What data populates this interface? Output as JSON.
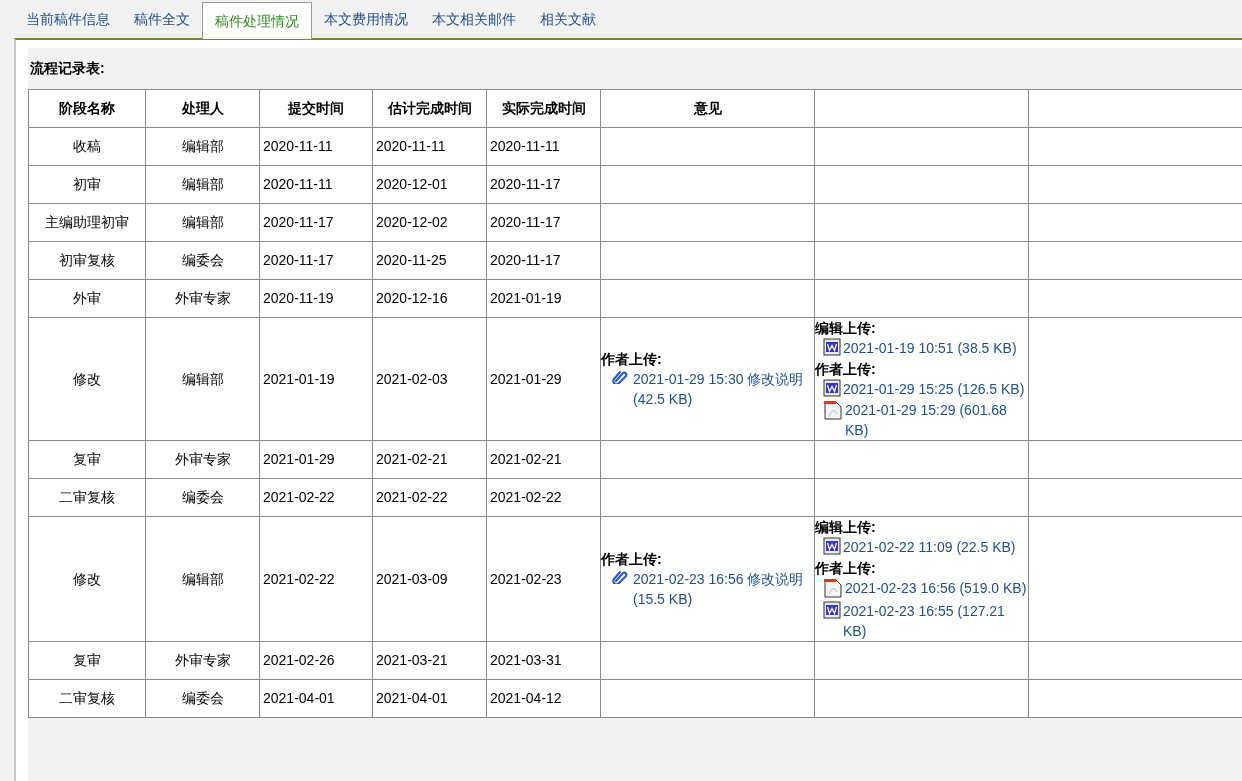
{
  "tabs": [
    {
      "label": "当前稿件信息",
      "selected": false
    },
    {
      "label": "稿件全文",
      "selected": false
    },
    {
      "label": "稿件处理情况",
      "selected": true
    },
    {
      "label": "本文费用情况",
      "selected": false
    },
    {
      "label": "本文相关邮件",
      "selected": false
    },
    {
      "label": "相关文献",
      "selected": false
    }
  ],
  "section_title": "流程记录表:",
  "table": {
    "columns": [
      "阶段名称",
      "处理人",
      "提交时间",
      "估计完成时间",
      "实际完成时间",
      "意见"
    ],
    "rows": [
      {
        "stage": "收稿",
        "handler": "编辑部",
        "submitted": "2020-11-11",
        "estimated": "2020-11-11",
        "actual": "2020-11-11"
      },
      {
        "stage": "初审",
        "handler": "编辑部",
        "submitted": "2020-11-11",
        "estimated": "2020-12-01",
        "actual": "2020-11-17"
      },
      {
        "stage": "主编助理初审",
        "handler": "编辑部",
        "submitted": "2020-11-17",
        "estimated": "2020-12-02",
        "actual": "2020-11-17"
      },
      {
        "stage": "初审复核",
        "handler": "编委会",
        "submitted": "2020-11-17",
        "estimated": "2020-11-25",
        "actual": "2020-11-17"
      },
      {
        "stage": "外审",
        "handler": "外审专家",
        "submitted": "2020-11-19",
        "estimated": "2020-12-16",
        "actual": "2021-01-19"
      },
      {
        "stage": "修改",
        "handler": "编辑部",
        "submitted": "2021-01-19",
        "estimated": "2021-02-03",
        "actual": "2021-01-29",
        "opinion": [
          {
            "label": "作者上传:",
            "files": [
              {
                "kind": "attachment",
                "text": "2021-01-29 15:30 修改说明 (42.5 KB)"
              }
            ]
          }
        ],
        "column_7": [
          {
            "label": "编辑上传:",
            "files": [
              {
                "kind": "word",
                "text": "2021-01-19 10:51 (38.5 KB)"
              }
            ]
          },
          {
            "label": "作者上传:",
            "files": [
              {
                "kind": "word",
                "text": "2021-01-29 15:25 (126.5 KB)"
              },
              {
                "kind": "pdf",
                "text": "2021-01-29 15:29 (601.68 KB)"
              }
            ]
          }
        ]
      },
      {
        "stage": "复审",
        "handler": "外审专家",
        "submitted": "2021-01-29",
        "estimated": "2021-02-21",
        "actual": "2021-02-21"
      },
      {
        "stage": "二审复核",
        "handler": "编委会",
        "submitted": "2021-02-22",
        "estimated": "2021-02-22",
        "actual": "2021-02-22"
      },
      {
        "stage": "修改",
        "handler": "编辑部",
        "submitted": "2021-02-22",
        "estimated": "2021-03-09",
        "actual": "2021-02-23",
        "opinion": [
          {
            "label": "作者上传:",
            "files": [
              {
                "kind": "attachment",
                "text": "2021-02-23 16:56 修改说明 (15.5 KB)"
              }
            ]
          }
        ],
        "column_7": [
          {
            "label": "编辑上传:",
            "files": [
              {
                "kind": "word",
                "text": "2021-02-22 11:09 (22.5 KB)"
              }
            ]
          },
          {
            "label": "作者上传:",
            "files": [
              {
                "kind": "pdf",
                "text": "2021-02-23 16:56 (519.0 KB)"
              },
              {
                "kind": "word",
                "text": "2021-02-23 16:55 (127.21 KB)"
              }
            ]
          }
        ]
      },
      {
        "stage": "复审",
        "handler": "外审专家",
        "submitted": "2021-02-26",
        "estimated": "2021-03-21",
        "actual": "2021-03-31"
      },
      {
        "stage": "二审复核",
        "handler": "编委会",
        "submitted": "2021-04-01",
        "estimated": "2021-04-01",
        "actual": "2021-04-12"
      }
    ]
  }
}
